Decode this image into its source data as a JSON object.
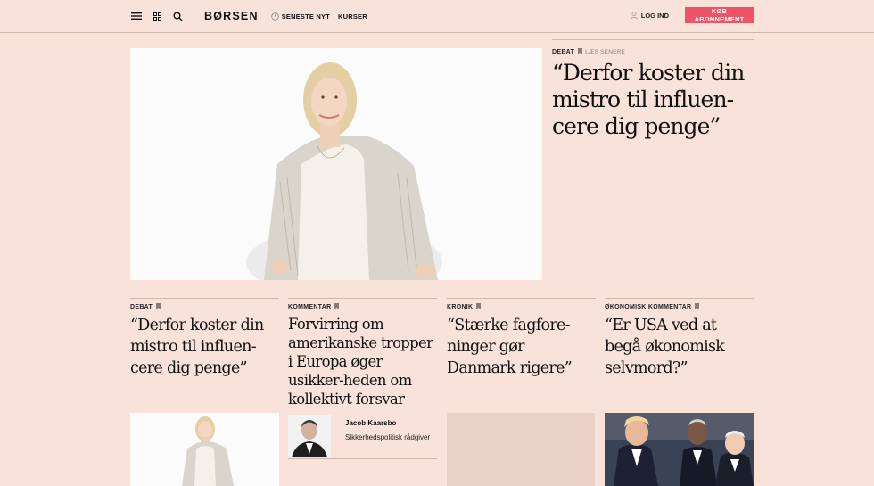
{
  "header": {
    "logo": "BØRSEN",
    "nav": {
      "latest": "SENESTE NYT",
      "courses": "KURSER"
    },
    "login": "LOG IND",
    "subscribe": "KØB ABONNEMENT"
  },
  "hero": {
    "kicker": "DEBAT",
    "read_later": "LÆS SENERE",
    "title": "“Derfor koster din mistro til influen-cere dig penge”"
  },
  "cards": [
    {
      "kicker": "DEBAT",
      "title": "“Derfor koster din mistro til influen-cere dig penge”"
    },
    {
      "kicker": "KOMMENTAR",
      "title": "Forvirring om amerikanske tropper i Europa øger usikker-heden om kollektivt forsvar"
    },
    {
      "kicker": "KRONIK",
      "title": "“Stærke fagfore-ninger gør Danmark rigere”"
    },
    {
      "kicker": "ØKONOMISK KOMMENTAR",
      "title": "“Er USA ved at begå økonomisk selvmord?”"
    }
  ],
  "author": {
    "name": "Jacob Kaarsbo",
    "role": "Sikkerhedspolitisk rådgiver"
  },
  "colors": {
    "background": "#f9e2d9",
    "accent": "#ef5466",
    "rule": "#cdb8ae"
  },
  "icons": [
    "menu-icon",
    "grid-icon",
    "search-icon",
    "clock-icon",
    "user-icon",
    "bookmark-icon"
  ]
}
